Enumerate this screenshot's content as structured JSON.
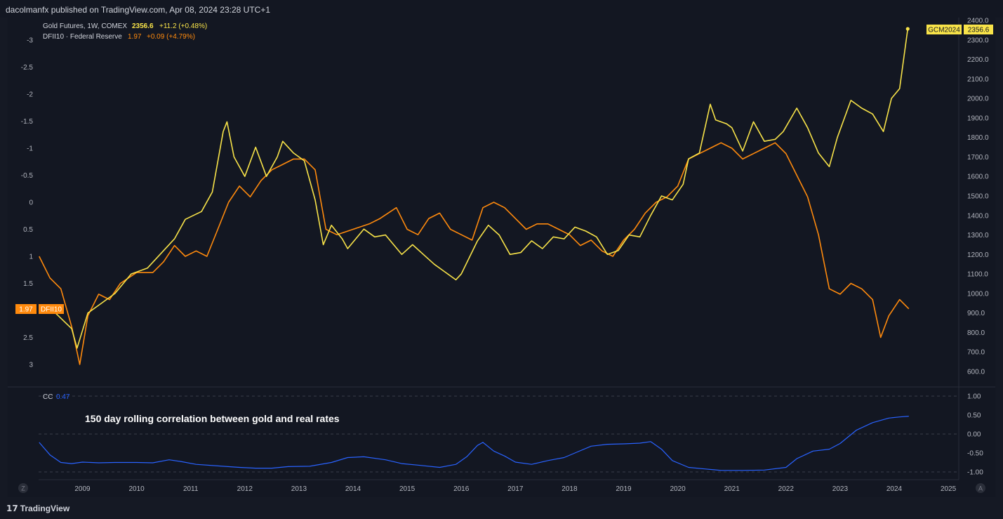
{
  "header": {
    "text": "dacolmanfx published on TradingView.com, Apr 08, 2024 23:28 UTC+1"
  },
  "legend": {
    "line1_name": "Gold Futures, 1W, COMEX",
    "line1_value": "2356.6",
    "line1_change": "+11.2 (+0.48%)",
    "line2_name": "DFII10 · Federal Reserve",
    "line2_value": "1.97",
    "line2_change": "+0.09 (+4.79%)"
  },
  "badges": {
    "gold_ticker": "GCM2024",
    "gold_value": "2356.6",
    "rate_value": "1.97",
    "rate_ticker": "DFII10"
  },
  "pane2": {
    "legend_name": "CC",
    "legend_value": "0.47",
    "annotation": "150 day rolling correlation between gold and real rates"
  },
  "footer": {
    "logo": "TradingView"
  },
  "buttons": {
    "z": "Z",
    "a": "A"
  },
  "colors": {
    "background": "#151924",
    "gold": "#f8e349",
    "rate": "#ff8a0d",
    "correlation": "#2962ff",
    "grid": "#3a3e4a"
  },
  "chart_data": [
    {
      "type": "line",
      "title": "",
      "x_ticks": [
        "2009",
        "2010",
        "2011",
        "2012",
        "2013",
        "2014",
        "2015",
        "2016",
        "2017",
        "2018",
        "2019",
        "2020",
        "2021",
        "2022",
        "2023",
        "2024",
        "2025"
      ],
      "right_axis": {
        "label": "",
        "ticks": [
          "2400.0",
          "2300.0",
          "2200.0",
          "2100.0",
          "2000.0",
          "1900.0",
          "1800.0",
          "1700.0",
          "1600.0",
          "1500.0",
          "1400.0",
          "1300.0",
          "1200.0",
          "1100.0",
          "1000.0",
          "900.0",
          "800.0",
          "700.0",
          "600.0"
        ],
        "range": [
          600,
          2400
        ]
      },
      "left_axis": {
        "label": "",
        "inverted": true,
        "ticks": [
          "-3",
          "-2.5",
          "-2",
          "-1.5",
          "-1",
          "-0.5",
          "0",
          "0.5",
          "1",
          "1.5",
          "2",
          "2.5",
          "3"
        ],
        "range": [
          -3,
          3
        ]
      },
      "series": [
        {
          "name": "Gold Futures, 1W, COMEX",
          "axis": "right",
          "x": [
            2008.2,
            2008.5,
            2008.8,
            2008.9,
            2009.1,
            2009.3,
            2009.6,
            2009.9,
            2010.2,
            2010.5,
            2010.7,
            2010.9,
            2011.2,
            2011.4,
            2011.6,
            2011.67,
            2011.8,
            2012.0,
            2012.2,
            2012.4,
            2012.6,
            2012.7,
            2012.9,
            2013.1,
            2013.3,
            2013.45,
            2013.6,
            2013.8,
            2013.9,
            2014.2,
            2014.4,
            2014.6,
            2014.9,
            2015.1,
            2015.3,
            2015.5,
            2015.9,
            2016.0,
            2016.3,
            2016.5,
            2016.7,
            2016.9,
            2017.1,
            2017.3,
            2017.5,
            2017.7,
            2017.9,
            2018.1,
            2018.3,
            2018.5,
            2018.7,
            2018.9,
            2019.1,
            2019.3,
            2019.5,
            2019.7,
            2019.9,
            2020.1,
            2020.2,
            2020.4,
            2020.6,
            2020.7,
            2020.9,
            2021.0,
            2021.2,
            2021.4,
            2021.6,
            2021.8,
            2021.95,
            2022.2,
            2022.4,
            2022.6,
            2022.8,
            2022.95,
            2023.2,
            2023.4,
            2023.6,
            2023.8,
            2023.95,
            2024.1,
            2024.25
          ],
          "values": [
            900,
            900,
            820,
            720,
            900,
            940,
            1000,
            1100,
            1130,
            1220,
            1280,
            1380,
            1420,
            1520,
            1830,
            1880,
            1700,
            1600,
            1750,
            1600,
            1700,
            1780,
            1720,
            1680,
            1480,
            1250,
            1350,
            1280,
            1230,
            1330,
            1290,
            1300,
            1200,
            1250,
            1200,
            1150,
            1070,
            1100,
            1270,
            1350,
            1300,
            1200,
            1210,
            1270,
            1230,
            1290,
            1280,
            1340,
            1320,
            1290,
            1200,
            1220,
            1300,
            1290,
            1400,
            1500,
            1480,
            1560,
            1690,
            1720,
            1970,
            1890,
            1870,
            1850,
            1730,
            1880,
            1780,
            1790,
            1830,
            1950,
            1850,
            1720,
            1650,
            1800,
            1990,
            1950,
            1920,
            1830,
            2000,
            2050,
            2356.6
          ]
        },
        {
          "name": "DFII10 · Federal Reserve",
          "axis": "left",
          "x": [
            2008.2,
            2008.4,
            2008.6,
            2008.8,
            2008.95,
            2009.1,
            2009.3,
            2009.5,
            2009.7,
            2010.0,
            2010.3,
            2010.5,
            2010.7,
            2010.9,
            2011.1,
            2011.3,
            2011.5,
            2011.7,
            2011.9,
            2012.1,
            2012.3,
            2012.5,
            2012.7,
            2012.9,
            2013.1,
            2013.3,
            2013.5,
            2013.7,
            2014.0,
            2014.3,
            2014.5,
            2014.8,
            2015.0,
            2015.2,
            2015.4,
            2015.6,
            2015.8,
            2016.0,
            2016.2,
            2016.4,
            2016.6,
            2016.8,
            2017.0,
            2017.2,
            2017.4,
            2017.6,
            2017.8,
            2018.0,
            2018.2,
            2018.4,
            2018.6,
            2018.8,
            2019.0,
            2019.2,
            2019.4,
            2019.6,
            2019.8,
            2020.0,
            2020.2,
            2020.4,
            2020.6,
            2020.8,
            2021.0,
            2021.2,
            2021.4,
            2021.6,
            2021.8,
            2022.0,
            2022.2,
            2022.4,
            2022.6,
            2022.8,
            2023.0,
            2023.2,
            2023.4,
            2023.6,
            2023.75,
            2023.9,
            2024.1,
            2024.27
          ],
          "values": [
            1.0,
            1.4,
            1.6,
            2.3,
            3.0,
            2.1,
            1.7,
            1.8,
            1.5,
            1.3,
            1.3,
            1.1,
            0.8,
            1.0,
            0.9,
            1.0,
            0.5,
            0.0,
            -0.3,
            -0.1,
            -0.4,
            -0.6,
            -0.7,
            -0.8,
            -0.8,
            -0.6,
            0.5,
            0.6,
            0.5,
            0.4,
            0.3,
            0.1,
            0.5,
            0.6,
            0.3,
            0.2,
            0.5,
            0.6,
            0.7,
            0.1,
            0.0,
            0.1,
            0.3,
            0.5,
            0.4,
            0.4,
            0.5,
            0.6,
            0.8,
            0.7,
            0.9,
            1.0,
            0.7,
            0.5,
            0.2,
            0.0,
            -0.1,
            -0.3,
            -0.8,
            -0.9,
            -1.0,
            -1.1,
            -1.0,
            -0.8,
            -0.9,
            -1.0,
            -1.1,
            -0.9,
            -0.5,
            -0.1,
            0.6,
            1.6,
            1.7,
            1.5,
            1.6,
            1.8,
            2.5,
            2.1,
            1.8,
            1.97
          ]
        }
      ]
    },
    {
      "type": "line",
      "title": "",
      "y_ticks": [
        "1.00",
        "0.50",
        "0.00",
        "-0.50",
        "-1.00"
      ],
      "ylim": [
        -1,
        1
      ],
      "series": [
        {
          "name": "CC",
          "x": [
            2008.2,
            2008.4,
            2008.6,
            2008.8,
            2009.0,
            2009.3,
            2009.6,
            2010.0,
            2010.3,
            2010.6,
            2010.8,
            2011.1,
            2011.5,
            2011.9,
            2012.2,
            2012.5,
            2012.8,
            2013.2,
            2013.6,
            2013.9,
            2014.2,
            2014.6,
            2014.9,
            2015.2,
            2015.6,
            2015.9,
            2016.1,
            2016.3,
            2016.4,
            2016.6,
            2016.8,
            2017.0,
            2017.3,
            2017.6,
            2017.9,
            2018.1,
            2018.4,
            2018.7,
            2019.0,
            2019.3,
            2019.5,
            2019.7,
            2019.9,
            2020.2,
            2020.5,
            2020.8,
            2021.2,
            2021.6,
            2022.0,
            2022.2,
            2022.5,
            2022.8,
            2023.0,
            2023.3,
            2023.6,
            2023.9,
            2024.1,
            2024.27
          ],
          "values": [
            -0.22,
            -0.55,
            -0.75,
            -0.78,
            -0.74,
            -0.76,
            -0.75,
            -0.75,
            -0.76,
            -0.68,
            -0.72,
            -0.8,
            -0.84,
            -0.88,
            -0.9,
            -0.9,
            -0.86,
            -0.85,
            -0.75,
            -0.62,
            -0.6,
            -0.68,
            -0.78,
            -0.82,
            -0.88,
            -0.8,
            -0.6,
            -0.3,
            -0.22,
            -0.45,
            -0.58,
            -0.74,
            -0.8,
            -0.7,
            -0.62,
            -0.5,
            -0.32,
            -0.27,
            -0.26,
            -0.24,
            -0.2,
            -0.4,
            -0.7,
            -0.88,
            -0.92,
            -0.96,
            -0.96,
            -0.95,
            -0.88,
            -0.65,
            -0.45,
            -0.4,
            -0.25,
            0.1,
            0.3,
            0.42,
            0.45,
            0.47
          ]
        }
      ]
    }
  ]
}
